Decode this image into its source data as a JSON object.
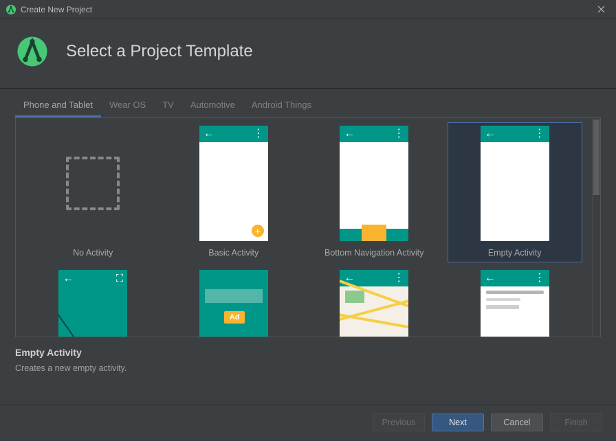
{
  "window": {
    "title": "Create New Project"
  },
  "header": {
    "title": "Select a Project Template"
  },
  "tabs": [
    {
      "label": "Phone and Tablet",
      "active": true
    },
    {
      "label": "Wear OS",
      "active": false
    },
    {
      "label": "TV",
      "active": false
    },
    {
      "label": "Automotive",
      "active": false
    },
    {
      "label": "Android Things",
      "active": false
    }
  ],
  "templates": {
    "row1": [
      {
        "key": "no-activity",
        "label": "No Activity"
      },
      {
        "key": "basic-activity",
        "label": "Basic Activity"
      },
      {
        "key": "bottom-navigation-activity",
        "label": "Bottom Navigation Activity"
      },
      {
        "key": "empty-activity",
        "label": "Empty Activity",
        "selected": true
      }
    ],
    "row2": [
      {
        "key": "fullscreen-activity",
        "label": ""
      },
      {
        "key": "admob-ads-activity",
        "label": ""
      },
      {
        "key": "google-maps-activity",
        "label": ""
      },
      {
        "key": "master-detail-activity",
        "label": ""
      }
    ]
  },
  "selected_template": {
    "name": "Empty Activity",
    "description": "Creates a new empty activity."
  },
  "icons": {
    "fab": "+",
    "ad": "Ad",
    "back_arrow": "←",
    "dots": "⋮",
    "fullscreen_expand": "⛶"
  },
  "colors": {
    "teal": "#009788",
    "amber": "#f9b32e",
    "window_bg": "#3c3f41",
    "primary_btn": "#365880",
    "selection_border": "#4a6ea9"
  },
  "footer": {
    "previous": "Previous",
    "next": "Next",
    "cancel": "Cancel",
    "finish": "Finish"
  }
}
